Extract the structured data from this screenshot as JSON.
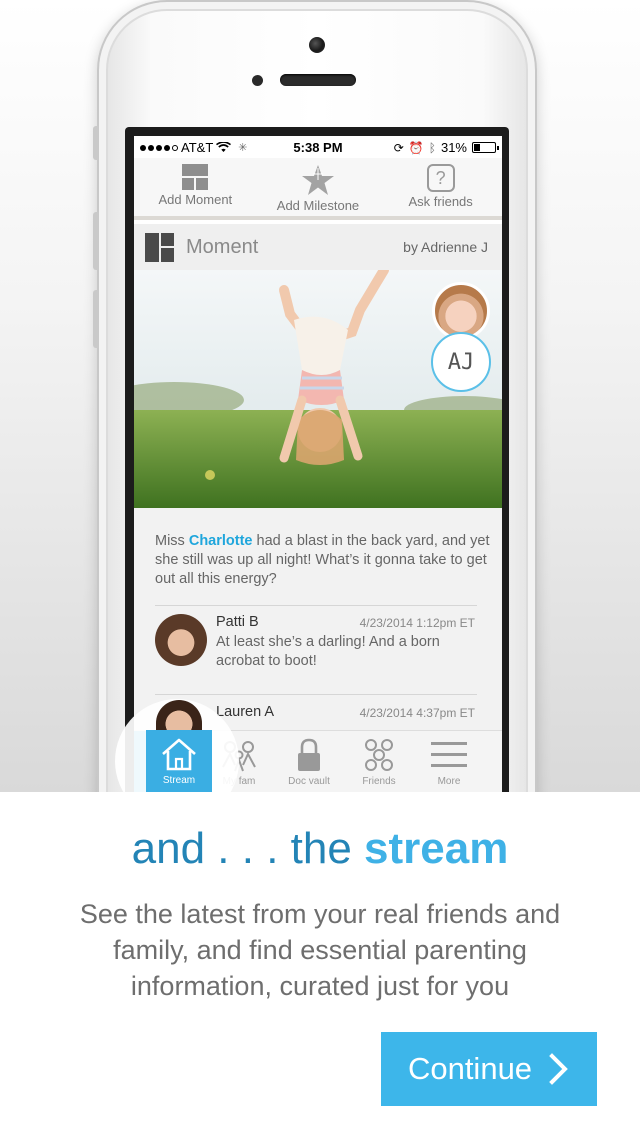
{
  "status_bar": {
    "carrier": "AT&T",
    "time": "5:38 PM",
    "battery": "31%",
    "battery_level": 0.31,
    "signal_bars_filled": 4
  },
  "action_bar": {
    "items": [
      {
        "label": "Add Moment",
        "icon": "moment-grid-icon"
      },
      {
        "label": "Add Milestone",
        "icon": "star-icon"
      },
      {
        "label": "Ask friends",
        "icon": "question-icon"
      }
    ]
  },
  "post": {
    "type_label": "Moment",
    "author": "by Adrienne J",
    "author_initials": "AJ",
    "caption_pre": "Miss ",
    "caption_name": "Charlotte",
    "caption_post": " had a blast in the back yard, and yet she still was up all night!  What’s it gonna take to get out all this energy?",
    "comments": [
      {
        "name": "Patti B",
        "date": "4/23/2014 1:12pm ET",
        "text": "At least she’s a darling!  And a born acrobat to boot!"
      },
      {
        "name": "Lauren A",
        "date": "4/23/2014 4:37pm ET",
        "text": ""
      }
    ]
  },
  "tab_bar": {
    "tabs": [
      {
        "label": "Stream",
        "icon": "home-icon",
        "active": true
      },
      {
        "label": "My fam",
        "icon": "family-icon",
        "active": false
      },
      {
        "label": "Doc vault",
        "icon": "lock-icon",
        "active": false
      },
      {
        "label": "Friends",
        "icon": "friends-icon",
        "active": false
      },
      {
        "label": "More",
        "icon": "menu-icon",
        "active": false
      }
    ]
  },
  "onboarding": {
    "headline_pre": "and . . . the ",
    "headline_em": "stream",
    "description": "See the latest from your real friends and family, and find essential parenting information, curated just for you",
    "continue_label": "Continue"
  },
  "colors": {
    "accent": "#3db6ea",
    "headline": "#2384b6",
    "link": "#1fa6dc"
  }
}
